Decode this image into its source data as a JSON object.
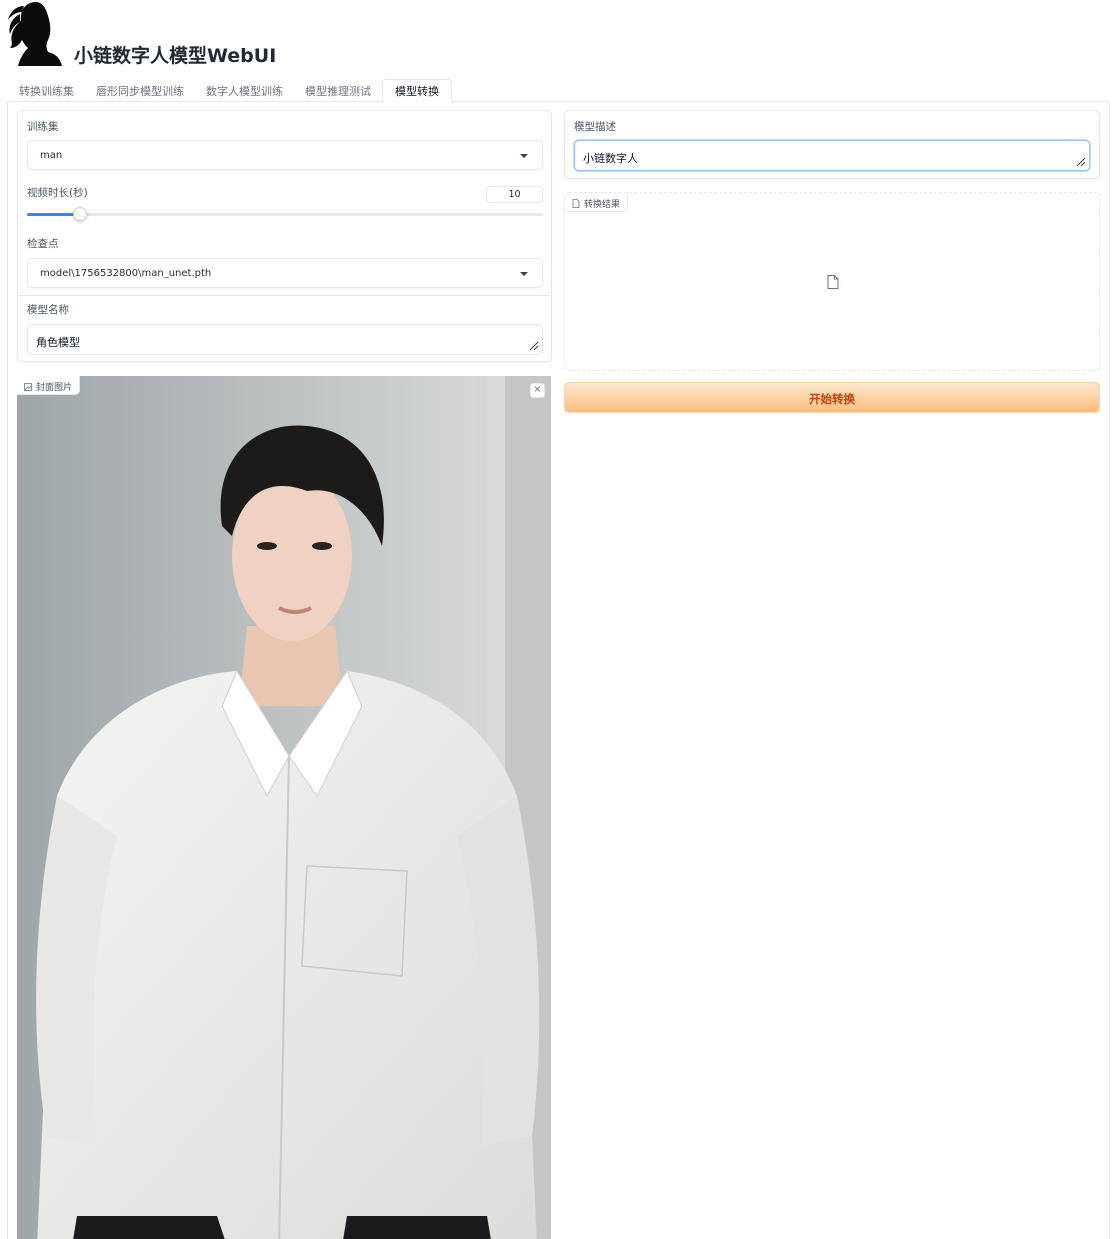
{
  "app": {
    "title": "小链数字人模型WebUI"
  },
  "tabs": [
    {
      "label": "转换训练集"
    },
    {
      "label": "唇形同步模型训练"
    },
    {
      "label": "数字人模型训练"
    },
    {
      "label": "模型推理测试"
    },
    {
      "label": "模型转换",
      "active": true
    }
  ],
  "left": {
    "dataset": {
      "label": "训练集",
      "value": "man"
    },
    "duration": {
      "label": "视频时长(秒)",
      "value": "10",
      "level_fraction": 0.1
    },
    "checkpoint": {
      "label": "检查点",
      "value": "model\\1756532800\\man_unet.pth"
    },
    "model_name": {
      "label": "模型名称",
      "value": "角色模型"
    },
    "cover": {
      "label": "封面图片",
      "close": "×"
    }
  },
  "right": {
    "description": {
      "label": "模型描述",
      "value": "小链数字人"
    },
    "result": {
      "label": "转换结果"
    },
    "start_button": {
      "label": "开始转换"
    }
  },
  "icons": {
    "logo": "woman-silhouette-icon",
    "image": "image-icon",
    "file": "file-icon",
    "caret": "chevron-down-icon",
    "resize": "resize-handle-icon"
  },
  "colors": {
    "accent": "#3b82f6",
    "primary_button_text": "#c2410c",
    "primary_button_bg": "#fdbd80"
  }
}
